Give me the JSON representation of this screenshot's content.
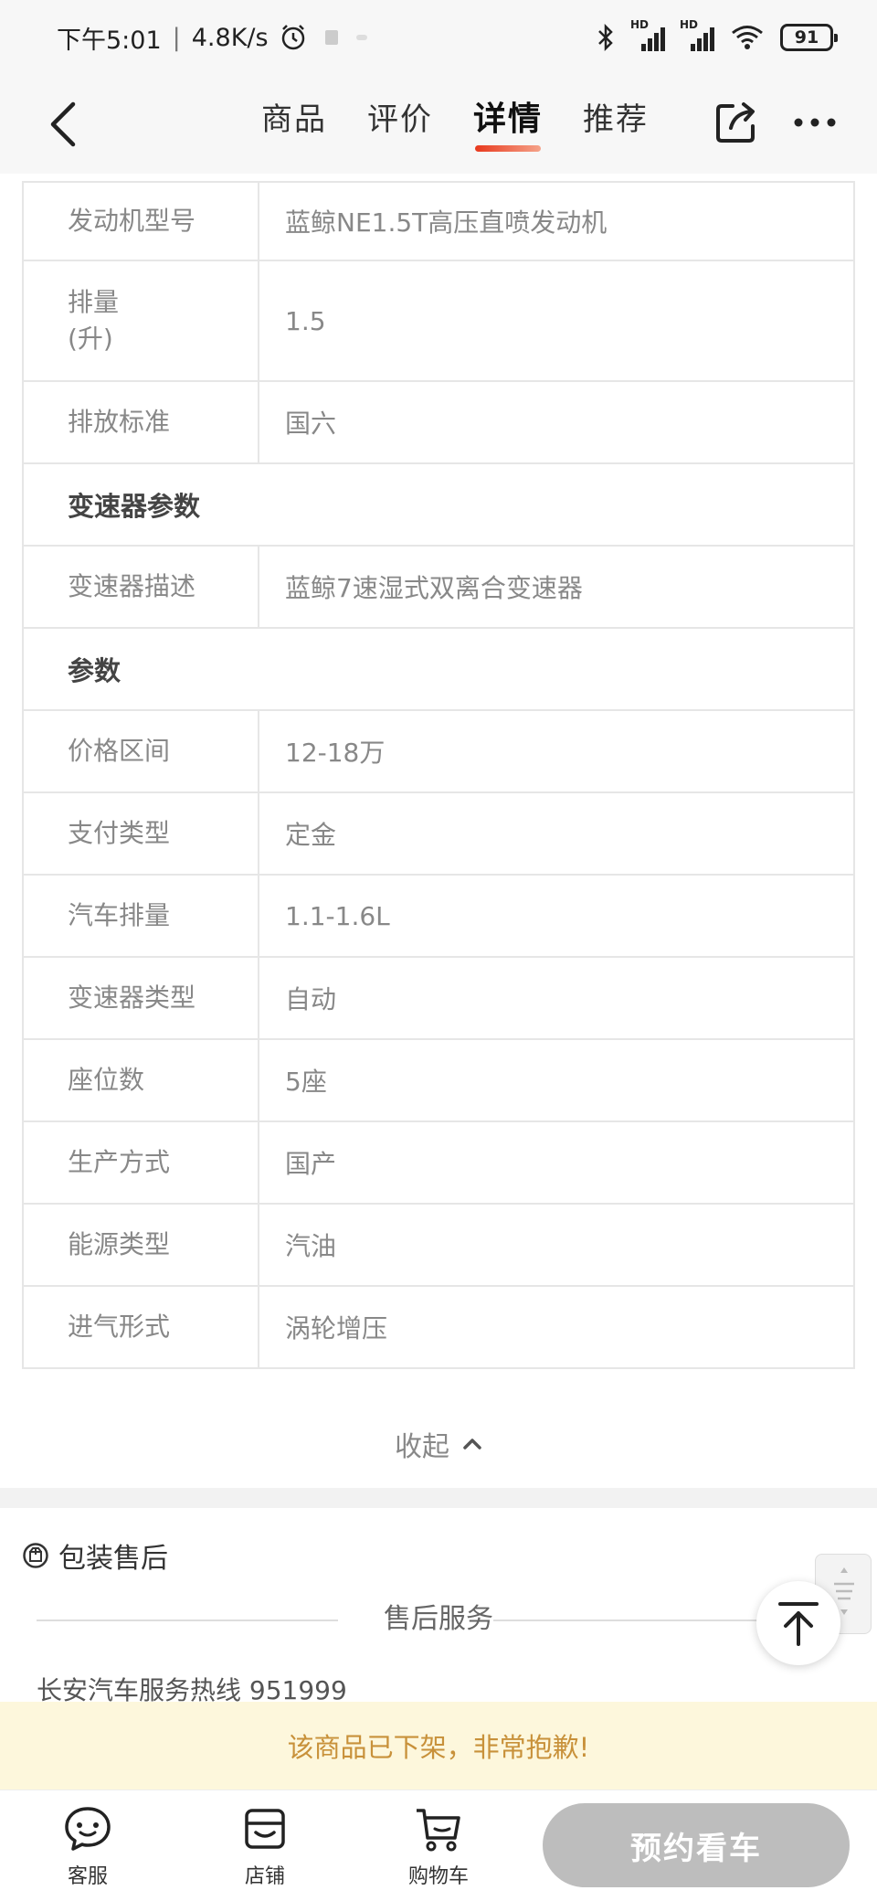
{
  "status_bar": {
    "time": "下午5:01",
    "net_speed": "4.8K/s",
    "battery": "91",
    "hd_label": "HD"
  },
  "nav": {
    "tabs": [
      {
        "label": "商品",
        "active": false
      },
      {
        "label": "评价",
        "active": false
      },
      {
        "label": "详情",
        "active": true
      },
      {
        "label": "推荐",
        "active": false
      }
    ]
  },
  "specs": {
    "engine_rows": [
      {
        "key": "发动机型号",
        "value": "蓝鲸NE1.5T高压直喷发动机"
      },
      {
        "key": "排量\n(升)",
        "value": "1.5"
      },
      {
        "key": "排放标准",
        "value": "国六"
      }
    ],
    "transmission_section": "变速器参数",
    "transmission_rows": [
      {
        "key": "变速器描述",
        "value": "蓝鲸7速湿式双离合变速器"
      }
    ],
    "params_section": "参数",
    "params_rows": [
      {
        "key": "价格区间",
        "value": "12-18万"
      },
      {
        "key": "支付类型",
        "value": "定金"
      },
      {
        "key": "汽车排量",
        "value": "1.1-1.6L"
      },
      {
        "key": "变速器类型",
        "value": "自动"
      },
      {
        "key": "座位数",
        "value": "5座"
      },
      {
        "key": "生产方式",
        "value": "国产"
      },
      {
        "key": "能源类型",
        "value": "汽油"
      },
      {
        "key": "进气形式",
        "value": "涡轮增压"
      }
    ]
  },
  "collapse_label": "收起",
  "after_sale": {
    "pack_title": "包装售后",
    "divider_label": "售后服务",
    "hotline": "长安汽车服务热线 951999"
  },
  "notice": "该商品已下架，非常抱歉!",
  "bottom_bar": {
    "service": "客服",
    "shop": "店铺",
    "cart": "购物车",
    "reserve": "预约看车"
  },
  "colors": {
    "accent": "#e8391d",
    "notice_bg": "#fdf7dc",
    "notice_text": "#c8913a",
    "button_disabled": "#bdbdbd"
  }
}
